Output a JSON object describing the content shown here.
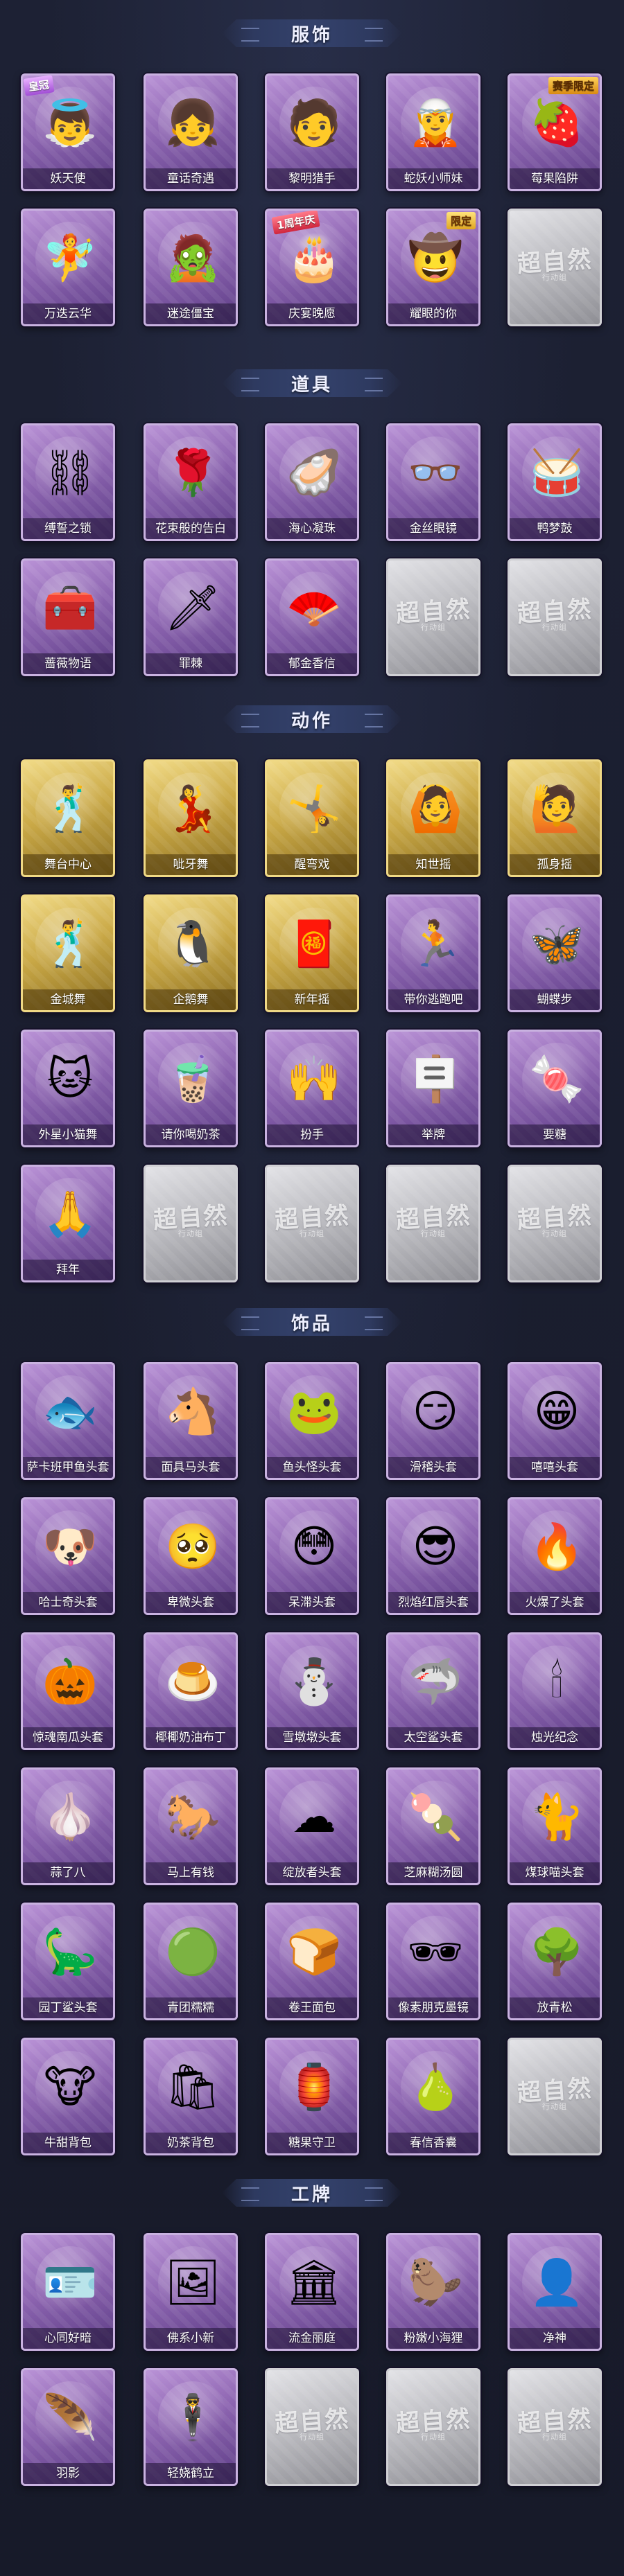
{
  "sections": [
    {
      "title": "服饰",
      "items": [
        {
          "label": "妖天使",
          "icon": "angel-costume-icon",
          "glyph": "👼",
          "badge": "皇冠",
          "badge_type": "rare",
          "style": "normal"
        },
        {
          "label": "童话奇遇",
          "icon": "fairytale-girl-icon",
          "glyph": "👧",
          "style": "normal"
        },
        {
          "label": "黎明猎手",
          "icon": "dawn-hunter-icon",
          "glyph": "🧑",
          "style": "normal"
        },
        {
          "label": "蛇妖小师妹",
          "icon": "snake-girl-icon",
          "glyph": "🧝",
          "style": "normal"
        },
        {
          "label": "莓果陷阱",
          "icon": "berry-trap-icon",
          "glyph": "🍓",
          "badge": "赛季限定",
          "badge_type": "event",
          "style": "normal"
        },
        {
          "label": "万迭云华",
          "icon": "cloud-robe-icon",
          "glyph": "🧚",
          "style": "normal"
        },
        {
          "label": "迷途僵宝",
          "icon": "lost-zombie-icon",
          "glyph": "🧟",
          "style": "normal"
        },
        {
          "label": "庆宴晚愿",
          "icon": "banquet-wish-icon",
          "glyph": "🎂",
          "badge": "1周年庆",
          "badge_type": "anniv",
          "style": "normal"
        },
        {
          "label": "耀眼的你",
          "icon": "dazzling-you-icon",
          "glyph": "🤠",
          "badge": "限定",
          "badge_type": "limited",
          "style": "normal"
        },
        {
          "label": "",
          "style": "empty"
        }
      ]
    },
    {
      "title": "道具",
      "items": [
        {
          "label": "缚誓之锁",
          "icon": "oath-chain-icon",
          "glyph": "⛓",
          "style": "normal"
        },
        {
          "label": "花束般的告白",
          "icon": "rose-bouquet-icon",
          "glyph": "🌹",
          "style": "normal"
        },
        {
          "label": "海心凝珠",
          "icon": "pearl-shell-icon",
          "glyph": "🦪",
          "style": "normal"
        },
        {
          "label": "金丝眼镜",
          "icon": "gold-glasses-icon",
          "glyph": "👓",
          "style": "normal"
        },
        {
          "label": "鸭梦鼓",
          "icon": "duck-drum-icon",
          "glyph": "🥁",
          "style": "normal"
        },
        {
          "label": "蔷薇物语",
          "icon": "first-aid-kit-icon",
          "glyph": "🧰",
          "style": "normal"
        },
        {
          "label": "罪棘",
          "icon": "thorn-staff-icon",
          "glyph": "🗡",
          "style": "normal"
        },
        {
          "label": "郁金香信",
          "icon": "tulip-fan-icon",
          "glyph": "🪭",
          "style": "normal"
        },
        {
          "label": "",
          "style": "empty"
        },
        {
          "label": "",
          "style": "empty"
        }
      ]
    },
    {
      "title": "动作",
      "items": [
        {
          "label": "舞台中心",
          "icon": "pose-center-stage-icon",
          "glyph": "🕺",
          "style": "gold"
        },
        {
          "label": "呲牙舞",
          "icon": "pose-grin-dance-icon",
          "glyph": "💃",
          "style": "gold"
        },
        {
          "label": "醒弯戏",
          "icon": "pose-bend-icon",
          "glyph": "🤸",
          "style": "gold"
        },
        {
          "label": "知世摇",
          "icon": "pose-sway-icon",
          "glyph": "🙆",
          "style": "gold"
        },
        {
          "label": "孤身摇",
          "icon": "pose-solo-sway-icon",
          "glyph": "🙋",
          "style": "gold"
        },
        {
          "label": "金城舞",
          "icon": "pose-golden-dance-icon",
          "glyph": "🕺",
          "style": "gold"
        },
        {
          "label": "企鹅舞",
          "icon": "pose-penguin-icon",
          "glyph": "🐧",
          "style": "gold"
        },
        {
          "label": "新年摇",
          "icon": "pose-new-year-icon",
          "glyph": "🧧",
          "style": "gold"
        },
        {
          "label": "带你逃跑吧",
          "icon": "pose-run-icon",
          "glyph": "🏃",
          "style": "normal"
        },
        {
          "label": "蝴蝶步",
          "icon": "pose-butterfly-icon",
          "glyph": "🦋",
          "style": "normal"
        },
        {
          "label": "外星小猫舞",
          "icon": "pose-alien-cat-icon",
          "glyph": "🐱",
          "style": "normal"
        },
        {
          "label": "请你喝奶茶",
          "icon": "pose-milk-tea-icon",
          "glyph": "🧋",
          "style": "normal"
        },
        {
          "label": "扮手",
          "icon": "pose-hand-icon",
          "glyph": "🙌",
          "style": "normal"
        },
        {
          "label": "举牌",
          "icon": "pose-sign-icon",
          "glyph": "🪧",
          "style": "normal"
        },
        {
          "label": "要糖",
          "icon": "pose-candy-icon",
          "glyph": "🍬",
          "style": "normal"
        },
        {
          "label": "拜年",
          "icon": "pose-greeting-icon",
          "glyph": "🙏",
          "style": "normal"
        },
        {
          "label": "",
          "style": "empty"
        },
        {
          "label": "",
          "style": "empty"
        },
        {
          "label": "",
          "style": "empty"
        },
        {
          "label": "",
          "style": "empty"
        }
      ]
    },
    {
      "title": "饰品",
      "items": [
        {
          "label": "萨卡班甲鱼头套",
          "icon": "fish-head-icon",
          "glyph": "🐟",
          "style": "normal"
        },
        {
          "label": "面具马头套",
          "icon": "horse-mask-icon",
          "glyph": "🐴",
          "style": "normal"
        },
        {
          "label": "鱼头怪头套",
          "icon": "fish-monster-icon",
          "glyph": "🐸",
          "style": "normal"
        },
        {
          "label": "滑稽头套",
          "icon": "funny-face-icon",
          "glyph": "😏",
          "style": "normal"
        },
        {
          "label": "嘻嘻头套",
          "icon": "grin-face-icon",
          "glyph": "😁",
          "style": "normal"
        },
        {
          "label": "哈士奇头套",
          "icon": "husky-head-icon",
          "glyph": "🐶",
          "style": "normal"
        },
        {
          "label": "卑微头套",
          "icon": "humble-face-icon",
          "glyph": "🥺",
          "style": "normal"
        },
        {
          "label": "呆滞头套",
          "icon": "dazed-face-icon",
          "glyph": "😳",
          "style": "normal"
        },
        {
          "label": "烈焰红唇头套",
          "icon": "pikachu-lips-icon",
          "glyph": "😎",
          "style": "normal"
        },
        {
          "label": "火爆了头套",
          "icon": "fire-head-icon",
          "glyph": "🔥",
          "style": "normal"
        },
        {
          "label": "惊魂南瓜头套",
          "icon": "pumpkin-head-icon",
          "glyph": "🎃",
          "style": "normal"
        },
        {
          "label": "椰椰奶油布丁",
          "icon": "pudding-icon",
          "glyph": "🍮",
          "style": "normal"
        },
        {
          "label": "雪墩墩头套",
          "icon": "snowman-head-icon",
          "glyph": "⛄",
          "style": "normal"
        },
        {
          "label": "太空鲨头套",
          "icon": "space-shark-icon",
          "glyph": "🦈",
          "style": "normal"
        },
        {
          "label": "烛光纪念",
          "icon": "candle-icon",
          "glyph": "🕯",
          "style": "normal"
        },
        {
          "label": "蒜了八",
          "icon": "garlic-icon",
          "glyph": "🧄",
          "style": "normal"
        },
        {
          "label": "马上有钱",
          "icon": "lucky-horse-icon",
          "glyph": "🐎",
          "style": "normal"
        },
        {
          "label": "绽放者头套",
          "icon": "bloom-head-icon",
          "glyph": "☁",
          "style": "normal"
        },
        {
          "label": "芝麻糊汤圆",
          "icon": "tangyuan-icon",
          "glyph": "🍡",
          "style": "normal"
        },
        {
          "label": "煤球喵头套",
          "icon": "coal-cat-icon",
          "glyph": "🐈",
          "style": "normal"
        },
        {
          "label": "园丁鲨头套",
          "icon": "gardener-shark-icon",
          "glyph": "🦕",
          "style": "normal"
        },
        {
          "label": "青团糯糯",
          "icon": "green-dumpling-icon",
          "glyph": "🟢",
          "style": "normal"
        },
        {
          "label": "卷王面包",
          "icon": "bread-head-icon",
          "glyph": "🍞",
          "style": "normal"
        },
        {
          "label": "像素朋克墨镜",
          "icon": "pixel-sunglasses-icon",
          "glyph": "🕶",
          "style": "normal"
        },
        {
          "label": "放青松",
          "icon": "bonsai-icon",
          "glyph": "🌳",
          "style": "normal"
        },
        {
          "label": "牛甜背包",
          "icon": "cow-backpack-icon",
          "glyph": "🐮",
          "style": "normal"
        },
        {
          "label": "奶茶背包",
          "icon": "milk-tea-bag-icon",
          "glyph": "🛍",
          "style": "normal"
        },
        {
          "label": "糖果守卫",
          "icon": "candy-guard-icon",
          "glyph": "🏮",
          "style": "normal"
        },
        {
          "label": "春信香囊",
          "icon": "sachet-icon",
          "glyph": "🍐",
          "style": "normal"
        },
        {
          "label": "",
          "style": "empty"
        }
      ]
    },
    {
      "title": "工牌",
      "items": [
        {
          "label": "心同好暗",
          "icon": "badge-card-icon",
          "glyph": "🪪",
          "style": "normal"
        },
        {
          "label": "佛系小新",
          "icon": "badge-frame-icon",
          "glyph": "🖼",
          "style": "normal"
        },
        {
          "label": "流金丽庭",
          "icon": "badge-portal-icon",
          "glyph": "🏛",
          "style": "normal"
        },
        {
          "label": "粉嫩小海狸",
          "icon": "badge-beaver-icon",
          "glyph": "🦫",
          "style": "normal"
        },
        {
          "label": "净神",
          "icon": "badge-silhouette-icon",
          "glyph": "👤",
          "style": "normal"
        },
        {
          "label": "羽影",
          "icon": "badge-feather-icon",
          "glyph": "🪶",
          "style": "normal"
        },
        {
          "label": "轻娆鹤立",
          "icon": "badge-crane-icon",
          "glyph": "🕴",
          "style": "normal"
        },
        {
          "label": "",
          "style": "empty"
        },
        {
          "label": "",
          "style": "empty"
        },
        {
          "label": "",
          "style": "empty"
        }
      ]
    }
  ],
  "empty_card": {
    "brand": "超自然",
    "sub": "行动组"
  }
}
